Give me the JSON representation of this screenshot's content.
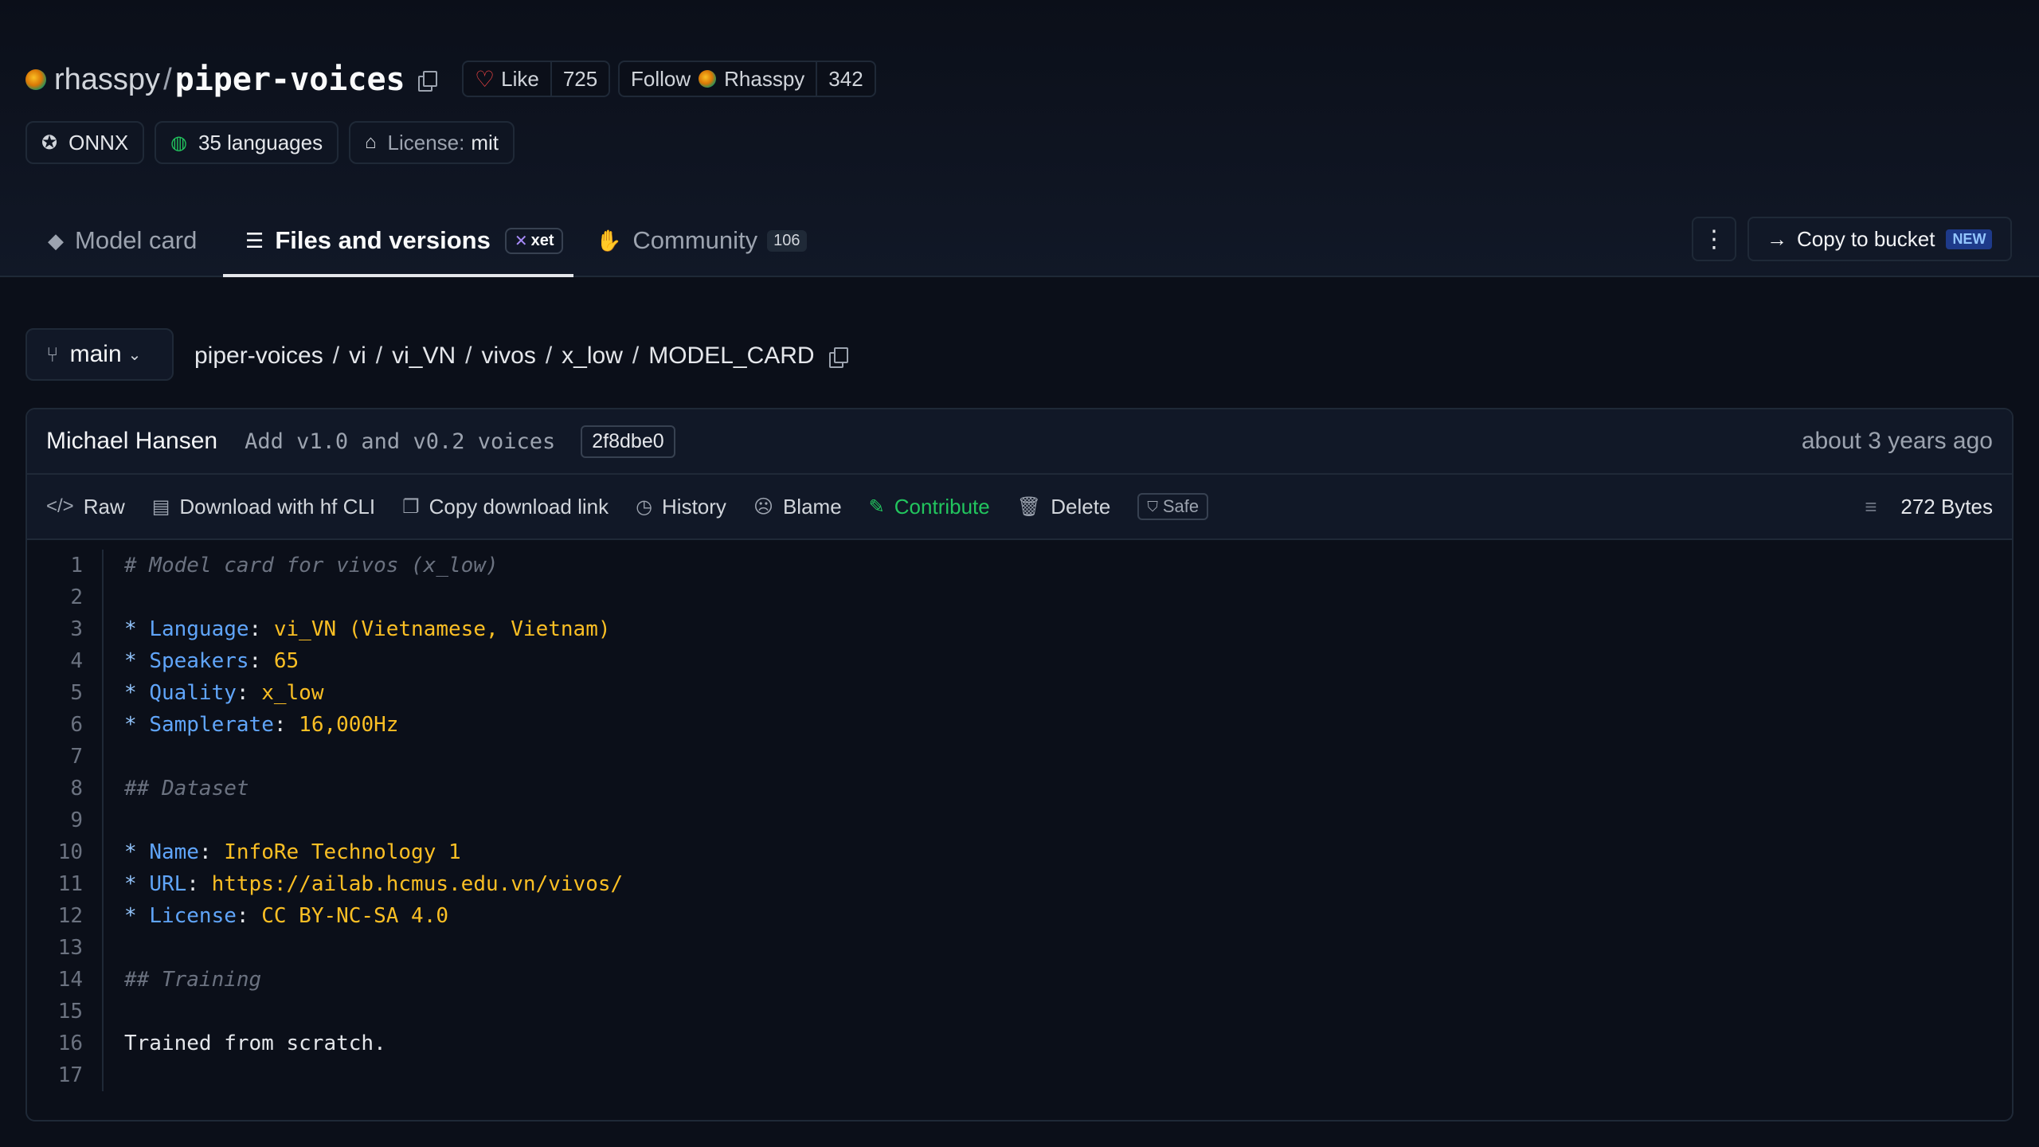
{
  "repo": {
    "owner": "rhasspy",
    "separator": "/",
    "name": "piper-voices",
    "like_label": "Like",
    "like_count": "725",
    "follow_label": "Follow",
    "follow_org": "Rhasspy",
    "follow_count": "342"
  },
  "tags": {
    "onnx": "ONNX",
    "languages": "35 languages",
    "license_label": "License:",
    "license_value": "mit"
  },
  "tabs": {
    "model_card": "Model card",
    "files": "Files and versions",
    "xet": "xet",
    "community": "Community",
    "community_count": "106",
    "copy_bucket": "Copy to bucket",
    "new_badge": "NEW"
  },
  "nav": {
    "branch": "main",
    "path": [
      "piper-voices",
      "vi",
      "vi_VN",
      "vivos",
      "x_low",
      "MODEL_CARD"
    ],
    "sep": "/"
  },
  "commit": {
    "author": "Michael Hansen",
    "message": "Add v1.0 and v0.2 voices",
    "sha": "2f8dbe0",
    "time": "about 3 years ago"
  },
  "actions": {
    "raw": "Raw",
    "download": "Download with hf CLI",
    "copy_link": "Copy download link",
    "history": "History",
    "blame": "Blame",
    "contribute": "Contribute",
    "delete": "Delete",
    "safe": "Safe",
    "size": "272 Bytes"
  },
  "code": {
    "l1": "# Model card for vivos (x_low)",
    "bullet": "*",
    "k_language": "Language",
    "v_language": "vi_VN (Vietnamese, Vietnam)",
    "k_speakers": "Speakers",
    "v_speakers": "65",
    "k_quality": "Quality",
    "v_quality": "x_low",
    "k_samplerate": "Samplerate",
    "v_samplerate": "16,000Hz",
    "h_dataset": "## Dataset",
    "k_name": "Name",
    "v_name": "InfoRe Technology 1",
    "k_url": "URL",
    "v_url": "https://ailab.hcmus.edu.vn/vivos/",
    "k_license": "License",
    "v_license": "CC BY-NC-SA 4.0",
    "h_training": "## Training",
    "trained": "Trained from scratch.",
    "line_numbers": [
      "1",
      "2",
      "3",
      "4",
      "5",
      "6",
      "7",
      "8",
      "9",
      "10",
      "11",
      "12",
      "13",
      "14",
      "15",
      "16",
      "17"
    ]
  }
}
